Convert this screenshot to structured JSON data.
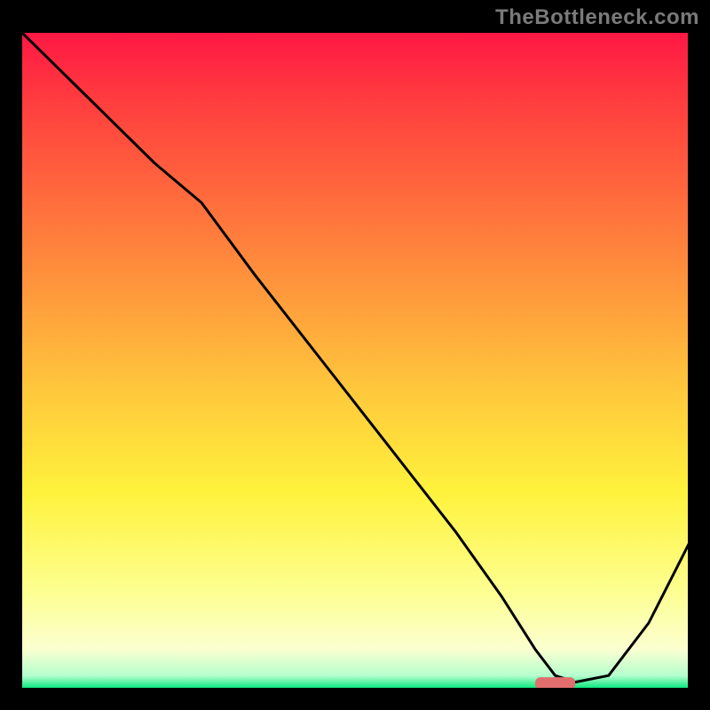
{
  "watermark": "TheBottleneck.com",
  "chart_data": {
    "type": "line",
    "title": "",
    "xlabel": "",
    "ylabel": "",
    "xlim": [
      0,
      100
    ],
    "ylim": [
      0,
      100
    ],
    "grid": false,
    "legend": false,
    "curve": {
      "name": "bottleneck-curve",
      "x": [
        0,
        10,
        20,
        27,
        35,
        45,
        55,
        65,
        72,
        77,
        80,
        83,
        88,
        94,
        100
      ],
      "y": [
        100,
        90,
        80,
        74,
        63,
        50,
        37,
        24,
        14,
        6,
        2,
        1,
        2,
        10,
        22
      ]
    },
    "marker": {
      "name": "target-marker",
      "x_start": 77,
      "x_end": 83,
      "y": 0.8,
      "color": "#e26d6d"
    },
    "gradient_stops": [
      {
        "pos": 0.0,
        "color": "#ff1744"
      },
      {
        "pos": 0.1,
        "color": "#ff3b3f"
      },
      {
        "pos": 0.25,
        "color": "#ff6a3d"
      },
      {
        "pos": 0.4,
        "color": "#ff9a3c"
      },
      {
        "pos": 0.55,
        "color": "#ffc93c"
      },
      {
        "pos": 0.7,
        "color": "#fff23c"
      },
      {
        "pos": 0.85,
        "color": "#fdff8f"
      },
      {
        "pos": 0.94,
        "color": "#fbffd0"
      },
      {
        "pos": 0.98,
        "color": "#b6ffce"
      },
      {
        "pos": 1.0,
        "color": "#00e67a"
      }
    ]
  }
}
